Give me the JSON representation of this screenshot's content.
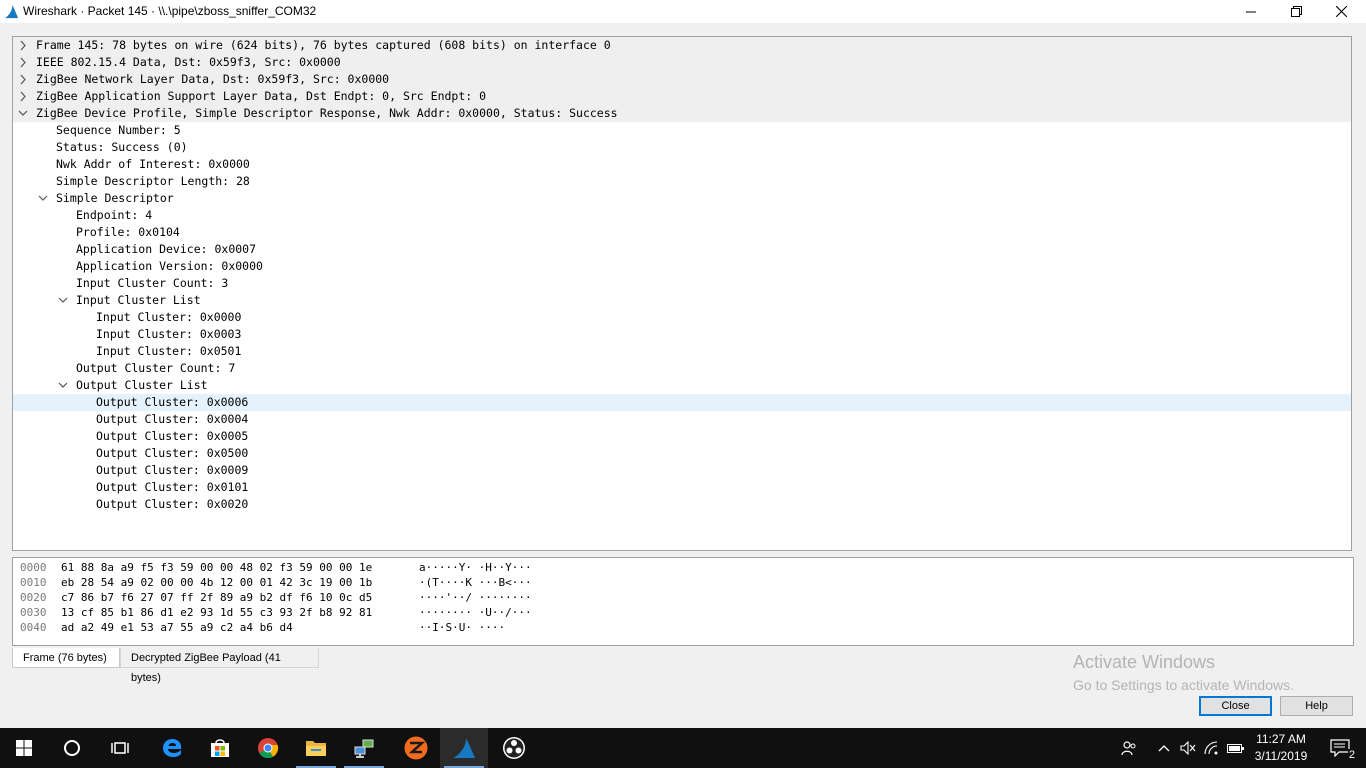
{
  "window": {
    "title": "Wireshark · Packet 145 · \\\\.\\pipe\\zboss_sniffer_COM32"
  },
  "tree": [
    {
      "indent": 0,
      "expander": "collapsed",
      "text": "Frame 145: 78 bytes on wire (624 bits), 76 bytes captured (608 bits) on interface 0",
      "style": "grey"
    },
    {
      "indent": 0,
      "expander": "collapsed",
      "text": "IEEE 802.15.4 Data, Dst: 0x59f3, Src: 0x0000",
      "style": "grey"
    },
    {
      "indent": 0,
      "expander": "collapsed",
      "text": "ZigBee Network Layer Data, Dst: 0x59f3, Src: 0x0000",
      "style": "grey"
    },
    {
      "indent": 0,
      "expander": "collapsed",
      "text": "ZigBee Application Support Layer Data, Dst Endpt: 0, Src Endpt: 0",
      "style": "grey"
    },
    {
      "indent": 0,
      "expander": "expanded",
      "text": "ZigBee Device Profile, Simple Descriptor Response, Nwk Addr: 0x0000, Status: Success",
      "style": "grey"
    },
    {
      "indent": 1,
      "expander": "none",
      "text": "Sequence Number: 5",
      "style": "normal"
    },
    {
      "indent": 1,
      "expander": "none",
      "text": "Status: Success (0)",
      "style": "normal"
    },
    {
      "indent": 1,
      "expander": "none",
      "text": "Nwk Addr of Interest: 0x0000",
      "style": "normal"
    },
    {
      "indent": 1,
      "expander": "none",
      "text": "Simple Descriptor Length: 28",
      "style": "normal"
    },
    {
      "indent": 1,
      "expander": "expanded",
      "text": "Simple Descriptor",
      "style": "normal"
    },
    {
      "indent": 2,
      "expander": "none",
      "text": "Endpoint: 4",
      "style": "normal"
    },
    {
      "indent": 2,
      "expander": "none",
      "text": "Profile: 0x0104",
      "style": "normal"
    },
    {
      "indent": 2,
      "expander": "none",
      "text": "Application Device: 0x0007",
      "style": "normal"
    },
    {
      "indent": 2,
      "expander": "none",
      "text": "Application Version: 0x0000",
      "style": "normal"
    },
    {
      "indent": 2,
      "expander": "none",
      "text": "Input Cluster Count: 3",
      "style": "normal"
    },
    {
      "indent": 2,
      "expander": "expanded",
      "text": "Input Cluster List",
      "style": "normal"
    },
    {
      "indent": 3,
      "expander": "none",
      "text": "Input Cluster: 0x0000",
      "style": "normal"
    },
    {
      "indent": 3,
      "expander": "none",
      "text": "Input Cluster: 0x0003",
      "style": "normal"
    },
    {
      "indent": 3,
      "expander": "none",
      "text": "Input Cluster: 0x0501",
      "style": "normal"
    },
    {
      "indent": 2,
      "expander": "none",
      "text": "Output Cluster Count: 7",
      "style": "normal"
    },
    {
      "indent": 2,
      "expander": "expanded",
      "text": "Output Cluster List",
      "style": "normal"
    },
    {
      "indent": 3,
      "expander": "none",
      "text": "Output Cluster: 0x0006",
      "style": "selected"
    },
    {
      "indent": 3,
      "expander": "none",
      "text": "Output Cluster: 0x0004",
      "style": "normal"
    },
    {
      "indent": 3,
      "expander": "none",
      "text": "Output Cluster: 0x0005",
      "style": "normal"
    },
    {
      "indent": 3,
      "expander": "none",
      "text": "Output Cluster: 0x0500",
      "style": "normal"
    },
    {
      "indent": 3,
      "expander": "none",
      "text": "Output Cluster: 0x0009",
      "style": "normal"
    },
    {
      "indent": 3,
      "expander": "none",
      "text": "Output Cluster: 0x0101",
      "style": "normal"
    },
    {
      "indent": 3,
      "expander": "none",
      "text": "Output Cluster: 0x0020",
      "style": "normal"
    }
  ],
  "hex": [
    {
      "offset": "0000",
      "bytes": "61 88 8a a9 f5 f3 59 00  00 48 02 f3 59 00 00 1e",
      "ascii": "a·····Y· ·H··Y···"
    },
    {
      "offset": "0010",
      "bytes": "eb 28 54 a9 02 00 00 4b  12 00 01 42 3c 19 00 1b",
      "ascii": "·(T····K ···B<···"
    },
    {
      "offset": "0020",
      "bytes": "c7 86 b7 f6 27 07 ff 2f  89 a9 b2 df f6 10 0c d5",
      "ascii": "····'··/ ········"
    },
    {
      "offset": "0030",
      "bytes": "13 cf 85 b1 86 d1 e2 93  1d 55 c3 93 2f b8 92 81",
      "ascii": "········ ·U··/···"
    },
    {
      "offset": "0040",
      "bytes": "ad a2 49 e1 53 a7 55 a9  c2 a4 b6 d4",
      "ascii": "··I·S·U· ····"
    }
  ],
  "tabs": [
    {
      "label": "Frame (76 bytes)",
      "active": true
    },
    {
      "label": "Decrypted ZigBee Payload (41 bytes)",
      "active": false
    }
  ],
  "watermark": {
    "line1": "Activate Windows",
    "line2": "Go to Settings to activate Windows."
  },
  "buttons": {
    "close": "Close",
    "help": "Help"
  },
  "taskbar": {
    "apps": [
      "windows-start",
      "cortana",
      "task-view",
      "edge",
      "store",
      "chrome",
      "file-explorer",
      "network-tool",
      "zboss-app",
      "wireshark",
      "obs"
    ],
    "clock_time": "11:27 AM",
    "clock_date": "3/11/2019",
    "notification_count": "2"
  },
  "colors": {
    "selected_row": "#e5f1fb",
    "header_row": "#efefef",
    "accent": "#0078d7"
  }
}
